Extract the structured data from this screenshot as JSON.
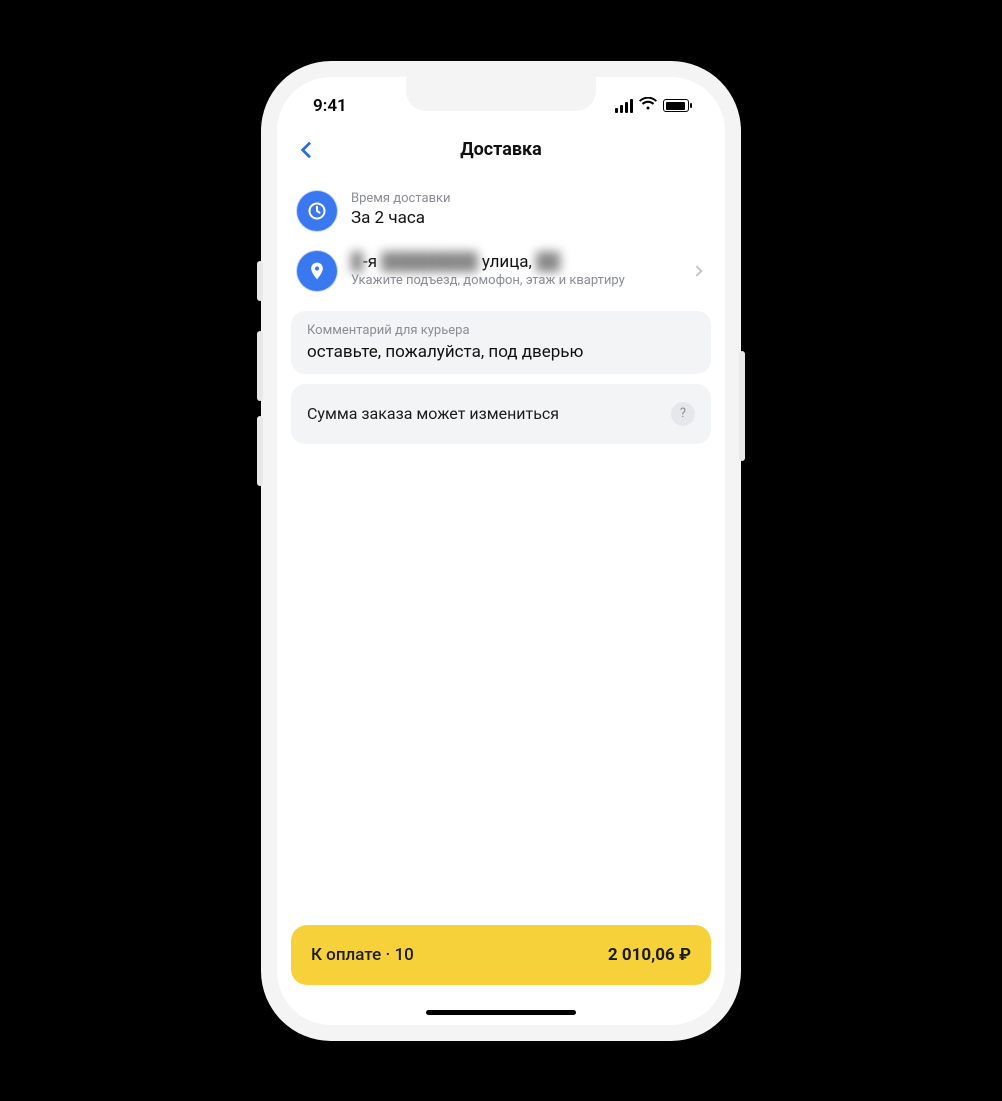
{
  "status": {
    "time": "9:41"
  },
  "nav": {
    "title": "Доставка"
  },
  "delivery_time": {
    "label": "Время доставки",
    "value": "За 2 часа"
  },
  "address": {
    "redacted_prefix": "█",
    "separator": "-я",
    "redacted_street": "████████",
    "street_word": "улица,",
    "redacted_number": "██",
    "hint": "Укажите подъезд, домофон, этаж и квартиру"
  },
  "comment": {
    "label": "Комментарий для курьера",
    "value": "оставьте, пожалуйста, под дверью"
  },
  "notice": {
    "text": "Сумма заказа может измениться",
    "help_glyph": "?"
  },
  "pay": {
    "left": "К оплате · 10",
    "right": "2 010,06 ₽"
  }
}
